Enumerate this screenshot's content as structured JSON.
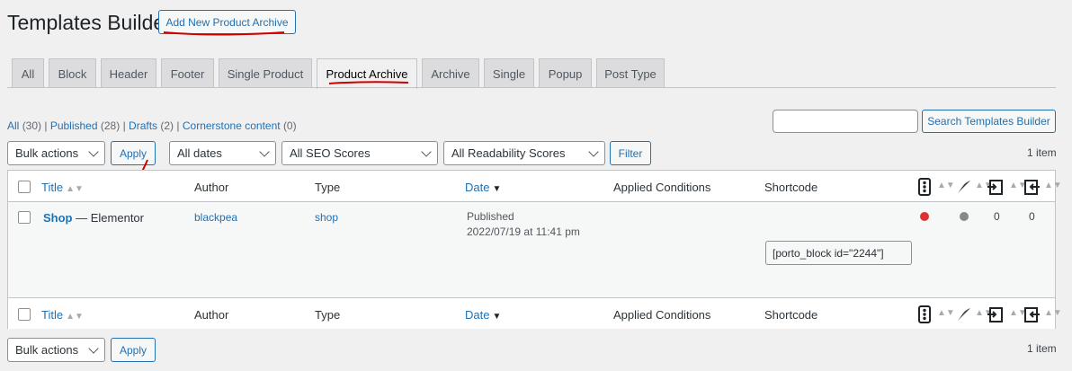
{
  "header": {
    "title": "Templates Builder",
    "add_new_label": "Add New Product Archive"
  },
  "tabs": [
    {
      "label": "All",
      "active": false
    },
    {
      "label": "Block",
      "active": false
    },
    {
      "label": "Header",
      "active": false
    },
    {
      "label": "Footer",
      "active": false
    },
    {
      "label": "Single Product",
      "active": false
    },
    {
      "label": "Product Archive",
      "active": true
    },
    {
      "label": "Archive",
      "active": false
    },
    {
      "label": "Single",
      "active": false
    },
    {
      "label": "Popup",
      "active": false
    },
    {
      "label": "Post Type",
      "active": false
    }
  ],
  "views": {
    "all": "All",
    "all_count": "(30)",
    "published": "Published",
    "published_count": "(28)",
    "drafts": "Drafts",
    "drafts_count": "(2)",
    "cornerstone": "Cornerstone content",
    "cornerstone_count": "(0)"
  },
  "search": {
    "value": "",
    "button_label": "Search Templates Builder"
  },
  "filters": {
    "bulk_actions": "Bulk actions",
    "apply": "Apply",
    "dates": "All dates",
    "seo": "All SEO Scores",
    "readability": "All Readability Scores",
    "filter": "Filter",
    "items_count": "1 item"
  },
  "columns": {
    "title": "Title",
    "author": "Author",
    "type": "Type",
    "date": "Date",
    "applied_conditions": "Applied Conditions",
    "shortcode": "Shortcode"
  },
  "rows": [
    {
      "title": "Shop",
      "state": "— Elementor",
      "author": "blackpea",
      "type": "shop",
      "status": "Published",
      "date": "2022/07/19 at 11:41 pm",
      "shortcode": "[porto_block id=\"2244\"]",
      "seo_color": "#dc3232",
      "readability_color": "#888888",
      "outgoing_links": "0",
      "incoming_links": "0"
    }
  ],
  "bottom": {
    "bulk_actions": "Bulk actions",
    "apply": "Apply",
    "items_count": "1 item"
  },
  "colors": {
    "accent": "#2271b1",
    "annotation": "#d00000"
  }
}
